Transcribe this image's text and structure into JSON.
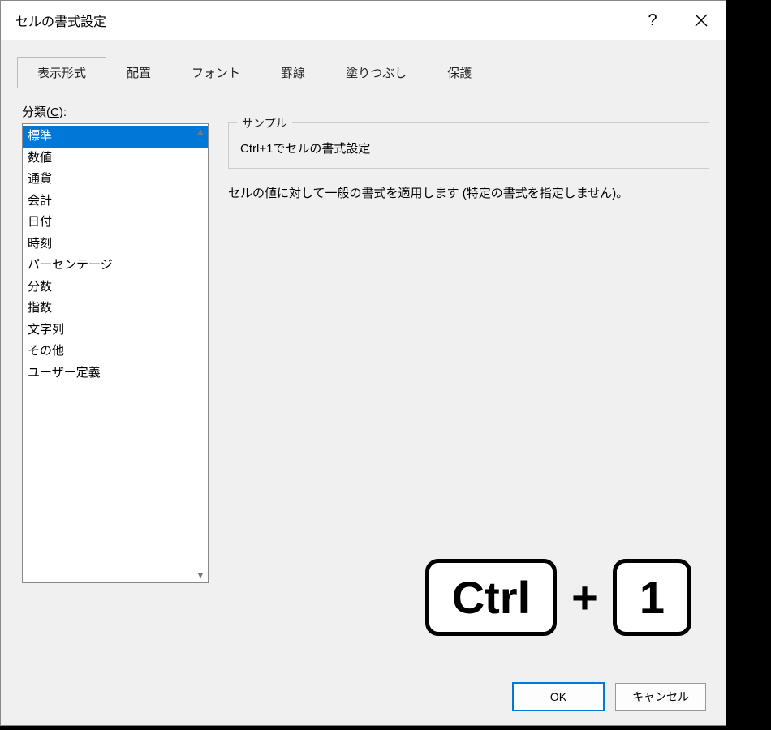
{
  "titlebar": {
    "title": "セルの書式設定",
    "help_label": "?",
    "close_label": "×"
  },
  "tabs": {
    "items": [
      {
        "label": "表示形式",
        "active": true
      },
      {
        "label": "配置",
        "active": false
      },
      {
        "label": "フォント",
        "active": false
      },
      {
        "label": "罫線",
        "active": false
      },
      {
        "label": "塗りつぶし",
        "active": false
      },
      {
        "label": "保護",
        "active": false
      }
    ]
  },
  "category": {
    "label_prefix": "分類(",
    "label_key": "C",
    "label_suffix": "):",
    "items": [
      "標準",
      "数値",
      "通貨",
      "会計",
      "日付",
      "時刻",
      "パーセンテージ",
      "分数",
      "指数",
      "文字列",
      "その他",
      "ユーザー定義"
    ],
    "selected_index": 0
  },
  "sample": {
    "legend": "サンプル",
    "value": "Ctrl+1でセルの書式設定"
  },
  "description": "セルの値に対して一般の書式を適用します (特定の書式を指定しません)。",
  "shortcut": {
    "key1": "Ctrl",
    "plus": "+",
    "key2": "1"
  },
  "footer": {
    "ok": "OK",
    "cancel": "キャンセル"
  }
}
